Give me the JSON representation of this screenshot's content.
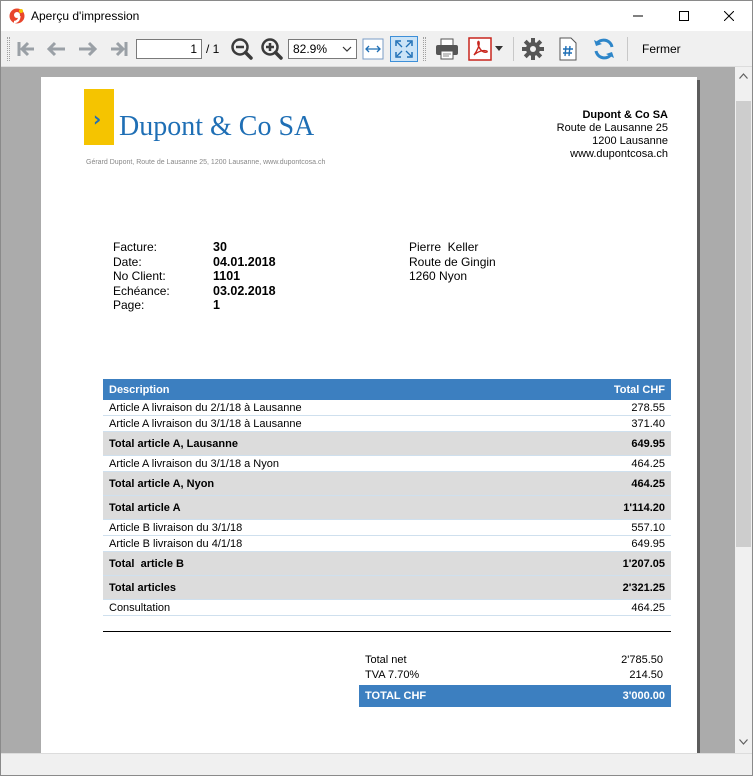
{
  "window": {
    "title": "Aperçu d'impression"
  },
  "toolbar": {
    "page_current": "1",
    "page_total": "/ 1",
    "zoom": "82.9%",
    "close_label": "Fermer"
  },
  "colors": {
    "accent_blue": "#3c7fc0",
    "logo_yellow": "#f5c400",
    "logo_text": "#1f6fb5"
  },
  "document": {
    "logo_text": "Dupont & Co SA",
    "logo_subline": "Gérard Dupont, Route de Lausanne 25, 1200 Lausanne, www.dupontcosa.ch",
    "company": {
      "name": "Dupont & Co SA",
      "street": "Route de Lausanne 25",
      "city": "1200 Lausanne",
      "web": "www.dupontcosa.ch"
    },
    "invoice": {
      "labels": [
        "Facture:",
        "Date:",
        "No Client:",
        "Echéance:",
        "Page:"
      ],
      "values": [
        "30",
        "04.01.2018",
        "1101",
        "03.02.2018",
        "1"
      ]
    },
    "recipient": {
      "name": "Pierre  Keller",
      "street": "Route de Gingin",
      "city": "1260 Nyon"
    },
    "table": {
      "headers": [
        "Description",
        "Total CHF"
      ],
      "rows": [
        {
          "desc": "Article A livraison du 2/1/18 à Lausanne",
          "amount": "278.55",
          "kind": "normal"
        },
        {
          "desc": "Article A livraison du 3/1/18 à Lausanne",
          "amount": "371.40",
          "kind": "normal"
        },
        {
          "desc": "Total article A, Lausanne",
          "amount": "649.95",
          "kind": "total"
        },
        {
          "desc": "Article A livraison du 3/1/18 a Nyon",
          "amount": "464.25",
          "kind": "normal"
        },
        {
          "desc": "Total article A, Nyon",
          "amount": "464.25",
          "kind": "total"
        },
        {
          "desc": "Total article A",
          "amount": "1'114.20",
          "kind": "total"
        },
        {
          "desc": "Article B livraison du 3/1/18",
          "amount": "557.10",
          "kind": "normal"
        },
        {
          "desc": "Article B livraison du 4/1/18",
          "amount": "649.95",
          "kind": "normal"
        },
        {
          "desc": "Total  article B",
          "amount": "1'207.05",
          "kind": "total"
        },
        {
          "desc": "Total articles",
          "amount": "2'321.25",
          "kind": "total"
        },
        {
          "desc": "Consultation",
          "amount": "464.25",
          "kind": "normal"
        }
      ]
    },
    "summary": {
      "net_label": "Total net",
      "net_value": "2'785.50",
      "vat_label": "TVA 7.70%",
      "vat_value": "214.50",
      "grand_label": "TOTAL CHF",
      "grand_value": "3'000.00"
    }
  }
}
